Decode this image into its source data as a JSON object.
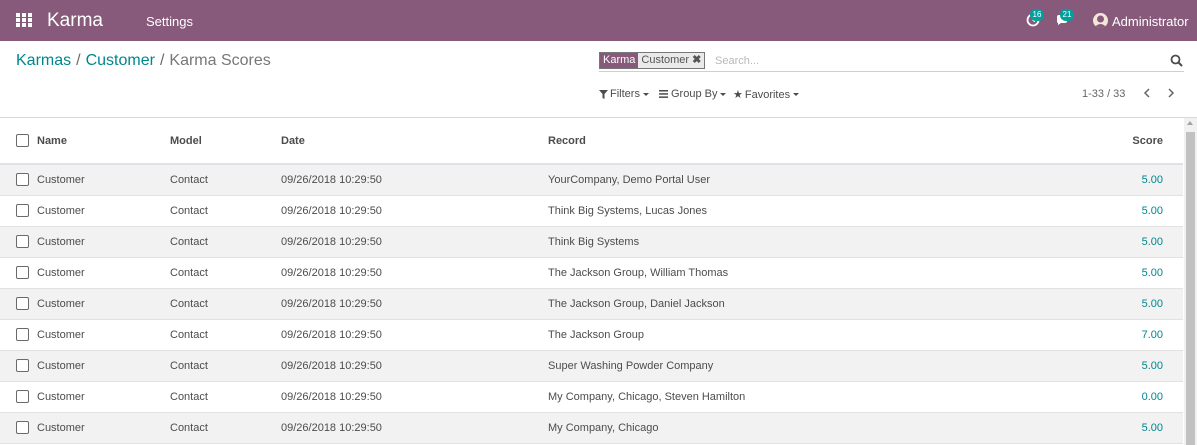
{
  "navbar": {
    "app_name": "Karma",
    "menu": [
      "Settings"
    ],
    "activity_count": "16",
    "message_count": "21",
    "user_name": "Administrator"
  },
  "breadcrumb": {
    "items": [
      "Karmas",
      "Customer"
    ],
    "current": "Karma Scores"
  },
  "search": {
    "facet_category": "Karma",
    "facet_value": "Customer",
    "placeholder": "Search..."
  },
  "options": {
    "filters": "Filters",
    "group_by": "Group By",
    "favorites": "Favorites"
  },
  "pager": {
    "value": "1-33 / 33"
  },
  "list": {
    "columns": [
      "Name",
      "Model",
      "Date",
      "Record",
      "Score"
    ],
    "rows": [
      {
        "name": "Customer",
        "model": "Contact",
        "date": "09/26/2018 10:29:50",
        "record": "YourCompany, Demo Portal User",
        "score": "5.00"
      },
      {
        "name": "Customer",
        "model": "Contact",
        "date": "09/26/2018 10:29:50",
        "record": "Think Big Systems, Lucas Jones",
        "score": "5.00"
      },
      {
        "name": "Customer",
        "model": "Contact",
        "date": "09/26/2018 10:29:50",
        "record": "Think Big Systems",
        "score": "5.00"
      },
      {
        "name": "Customer",
        "model": "Contact",
        "date": "09/26/2018 10:29:50",
        "record": "The Jackson Group, William Thomas",
        "score": "5.00"
      },
      {
        "name": "Customer",
        "model": "Contact",
        "date": "09/26/2018 10:29:50",
        "record": "The Jackson Group, Daniel Jackson",
        "score": "5.00"
      },
      {
        "name": "Customer",
        "model": "Contact",
        "date": "09/26/2018 10:29:50",
        "record": "The Jackson Group",
        "score": "7.00"
      },
      {
        "name": "Customer",
        "model": "Contact",
        "date": "09/26/2018 10:29:50",
        "record": "Super Washing Powder Company",
        "score": "5.00"
      },
      {
        "name": "Customer",
        "model": "Contact",
        "date": "09/26/2018 10:29:50",
        "record": "My Company, Chicago, Steven Hamilton",
        "score": "0.00"
      },
      {
        "name": "Customer",
        "model": "Contact",
        "date": "09/26/2018 10:29:50",
        "record": "My Company, Chicago",
        "score": "5.00"
      }
    ]
  },
  "colors": {
    "navbar": "#875a7b",
    "link": "#00878c",
    "badge": "#00a09d"
  }
}
